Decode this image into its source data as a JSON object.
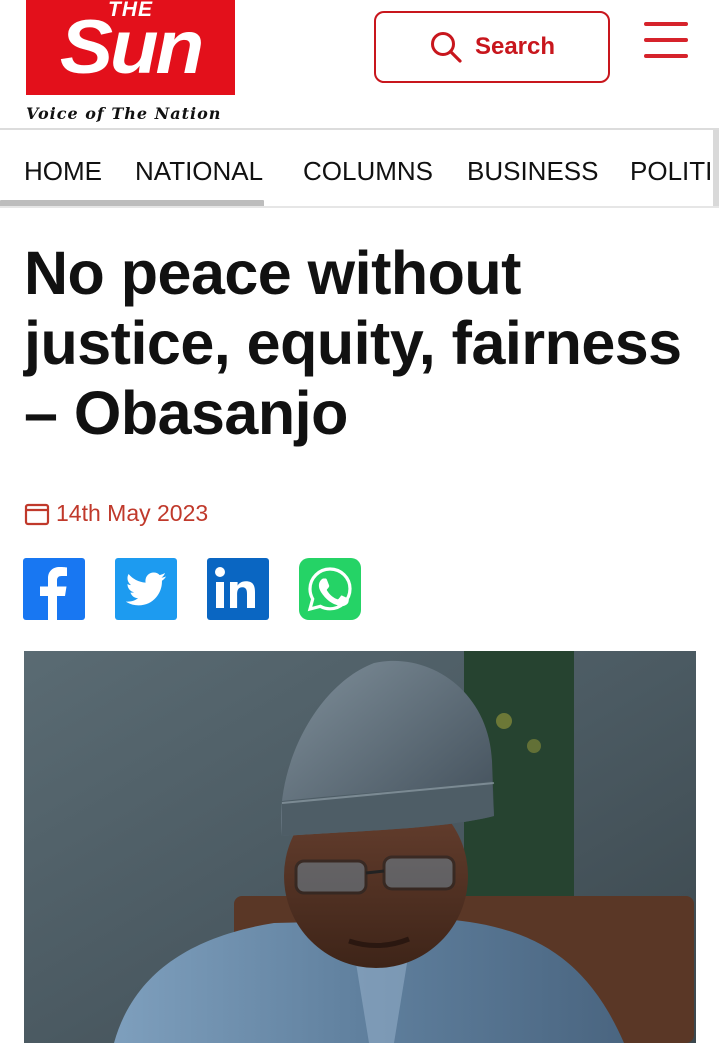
{
  "header": {
    "logo_top": "THE",
    "logo_main": "Sun",
    "tagline": "Voice of The Nation",
    "search_label": "Search",
    "brand_color": "#e3101b"
  },
  "nav": {
    "items": [
      {
        "label": "HOME"
      },
      {
        "label": "NATIONAL"
      },
      {
        "label": "COLUMNS"
      },
      {
        "label": "BUSINESS"
      },
      {
        "label": "POLITI"
      }
    ]
  },
  "article": {
    "headline": "No peace without justice, equity, fairness – Obasanjo",
    "date": "14th May 2023",
    "share": [
      {
        "network": "facebook",
        "icon": "facebook-icon",
        "color": "#1877f2"
      },
      {
        "network": "twitter",
        "icon": "twitter-icon",
        "color": "#1d9bf0"
      },
      {
        "network": "linkedin",
        "icon": "linkedin-icon",
        "color": "#0a66c2"
      },
      {
        "network": "whatsapp",
        "icon": "whatsapp-icon",
        "color": "#25d366"
      }
    ],
    "photo_icon": "portrait-photo"
  },
  "icons": {
    "search": "search-icon",
    "menu": "hamburger-menu-icon",
    "calendar": "calendar-icon"
  }
}
